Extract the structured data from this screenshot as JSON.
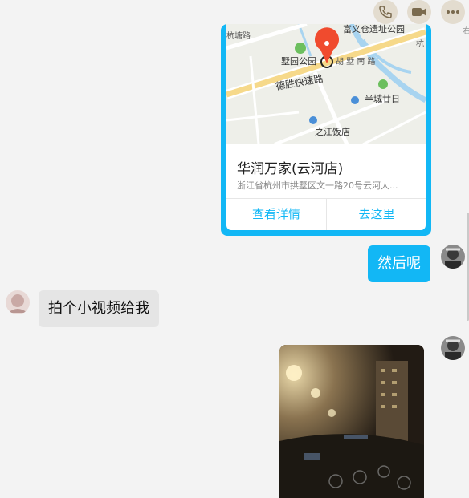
{
  "toolbar": {
    "icons": [
      "phone-icon",
      "video-camera-icon",
      "more-icon"
    ]
  },
  "edge_char": "右",
  "location_card": {
    "map_labels": {
      "park_top": "富义仓遗址公园",
      "park_left": "墅园公园",
      "road_main": "德胜快速路",
      "road_top_left": "杭塘路",
      "lake_right": "杭 皇",
      "lake_road": "胡 墅 南 路",
      "park_right": "半城廿日",
      "hotel": "之江饭店"
    },
    "name": "华润万家(云河店)",
    "address": "浙江省杭州市拱墅区文一路20号云河大...",
    "details_button": "查看详情",
    "go_button": "去这里"
  },
  "messages": [
    {
      "side": "right",
      "text": "然后呢"
    },
    {
      "side": "left",
      "text": "拍个小视频给我"
    },
    {
      "side": "right",
      "type": "video"
    }
  ],
  "colors": {
    "accent": "#12b7f5",
    "background": "#f3f3f3",
    "left_bubble": "#e5e5e5"
  }
}
